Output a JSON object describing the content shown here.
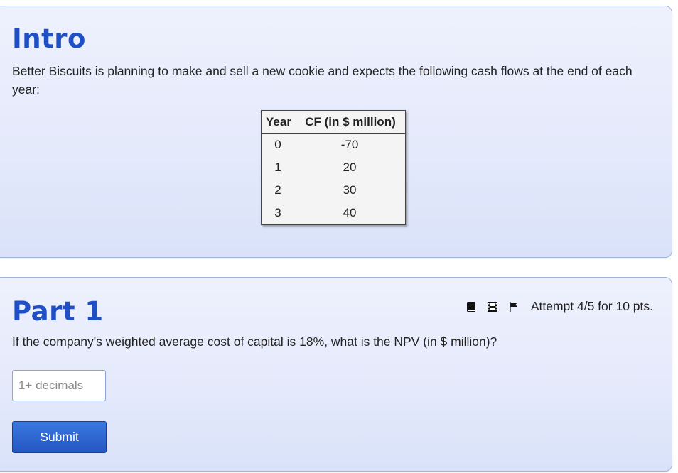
{
  "intro": {
    "title": "Intro",
    "text": "Better Biscuits is planning to make and sell a new cookie and expects the following cash flows at the end of each year:",
    "table": {
      "headers": [
        "Year",
        "CF (in $ million)"
      ],
      "rows": [
        [
          "0",
          "-70"
        ],
        [
          "1",
          "20"
        ],
        [
          "2",
          "30"
        ],
        [
          "3",
          "40"
        ]
      ]
    }
  },
  "part1": {
    "title": "Part 1",
    "question": "If the company's weighted average cost of capital is 18%, what is the NPV (in $ million)?",
    "toolbar": {
      "icons": [
        "book-icon",
        "film-icon",
        "flag-icon"
      ],
      "attempt": "Attempt 4/5 for 10 pts."
    },
    "answer": {
      "placeholder": "1+ decimals",
      "value": ""
    },
    "submit_label": "Submit"
  },
  "colors": {
    "heading": "#1f4fc4",
    "panel_bg": "#e4e9fb",
    "button": "#2456c2"
  }
}
